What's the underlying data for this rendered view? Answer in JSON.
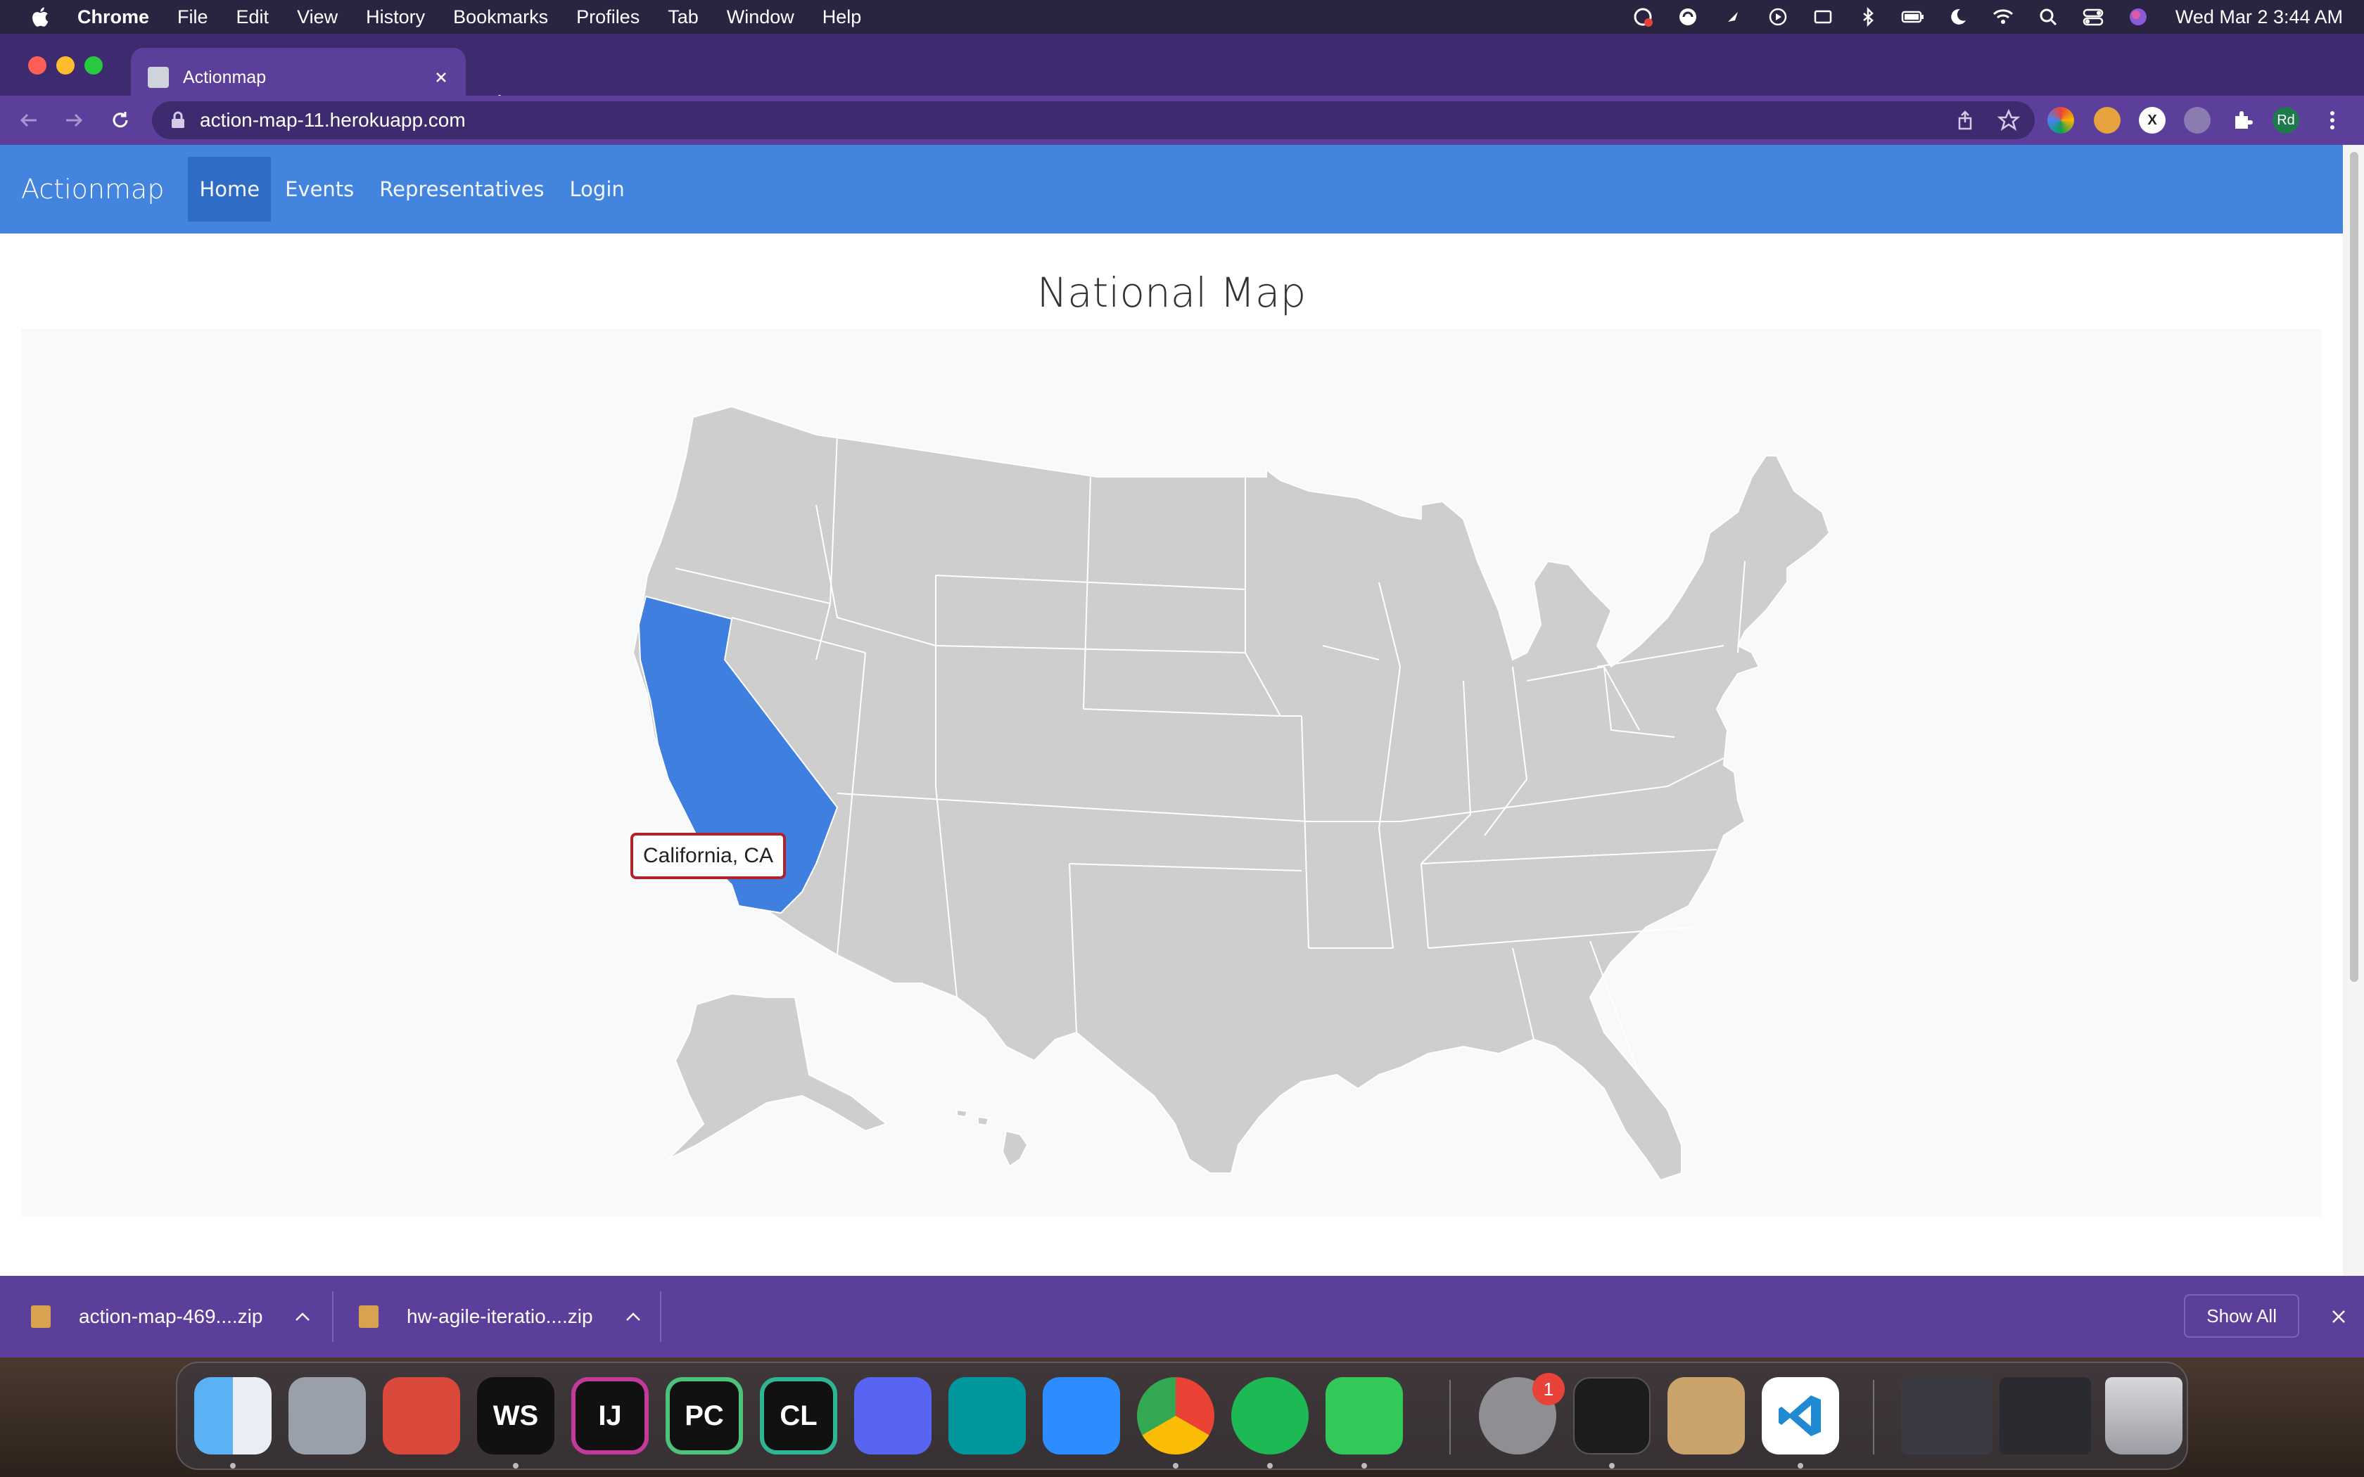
{
  "menubar": {
    "app_name": "Chrome",
    "items": [
      "File",
      "Edit",
      "View",
      "History",
      "Bookmarks",
      "Profiles",
      "Tab",
      "Window",
      "Help"
    ],
    "clock": "Wed Mar 2  3:44 AM"
  },
  "browser": {
    "tab_title": "Actionmap",
    "url": "action-map-11.herokuapp.com",
    "profile_initials": "Rd"
  },
  "site": {
    "brand": "Actionmap",
    "nav": [
      "Home",
      "Events",
      "Representatives",
      "Login"
    ],
    "active_nav": "Home",
    "title": "National Map",
    "tooltip": "California, CA",
    "highlight_color": "#3f7fdf",
    "state_color": "#cecece"
  },
  "downloads": {
    "items": [
      "action-map-469....zip",
      "hw-agile-iteratio....zip"
    ],
    "show_all": "Show All"
  },
  "dock": {
    "apps": [
      "Finder",
      "Launchpad",
      "Safari",
      "WebStorm",
      "IntelliJ IDEA",
      "PyCharm",
      "CLion",
      "Discord",
      "Arduino",
      "Zoom",
      "Google Chrome",
      "Spotify",
      "Messages",
      "System Preferences",
      "Terminal",
      "Archive Utility",
      "Visual Studio Code",
      "Trash"
    ],
    "short_labels": {
      "WebStorm": "WS",
      "IntelliJ IDEA": "IJ",
      "PyCharm": "PC",
      "CLion": "CL"
    },
    "settings_badge": "1"
  }
}
